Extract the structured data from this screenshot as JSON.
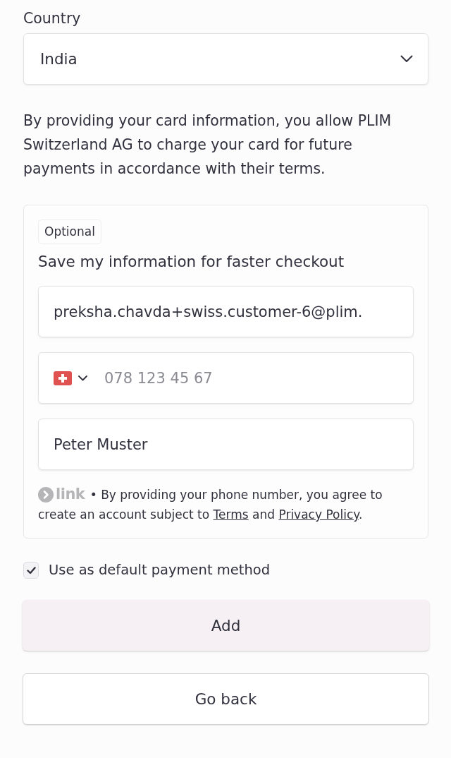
{
  "country": {
    "label": "Country",
    "value": "India"
  },
  "mandate_text": "By providing your card information, you allow PLIM Switzerland AG to charge your card for future payments in accordance with their terms.",
  "link_card": {
    "badge": "Optional",
    "title": "Save my information for faster checkout",
    "fields": [
      {
        "kind": "email",
        "value": "preksha.chavda+swiss.customer-6@plim."
      },
      {
        "kind": "phone",
        "placeholder": "078 123 45 67"
      },
      {
        "kind": "name",
        "value": "Peter Muster"
      }
    ],
    "legal": {
      "brand": "link",
      "sentence": "• By providing your phone number, you agree to create an account subject to",
      "terms_link": "Terms",
      "conjunction": "and",
      "privacy_link": "Privacy Policy",
      "end": "."
    }
  },
  "default_payment": {
    "label": "Use as default payment method",
    "checked": true
  },
  "buttons": [
    {
      "label": "Add",
      "kind": "primary"
    },
    {
      "label": "Go back",
      "kind": "secondary"
    }
  ]
}
